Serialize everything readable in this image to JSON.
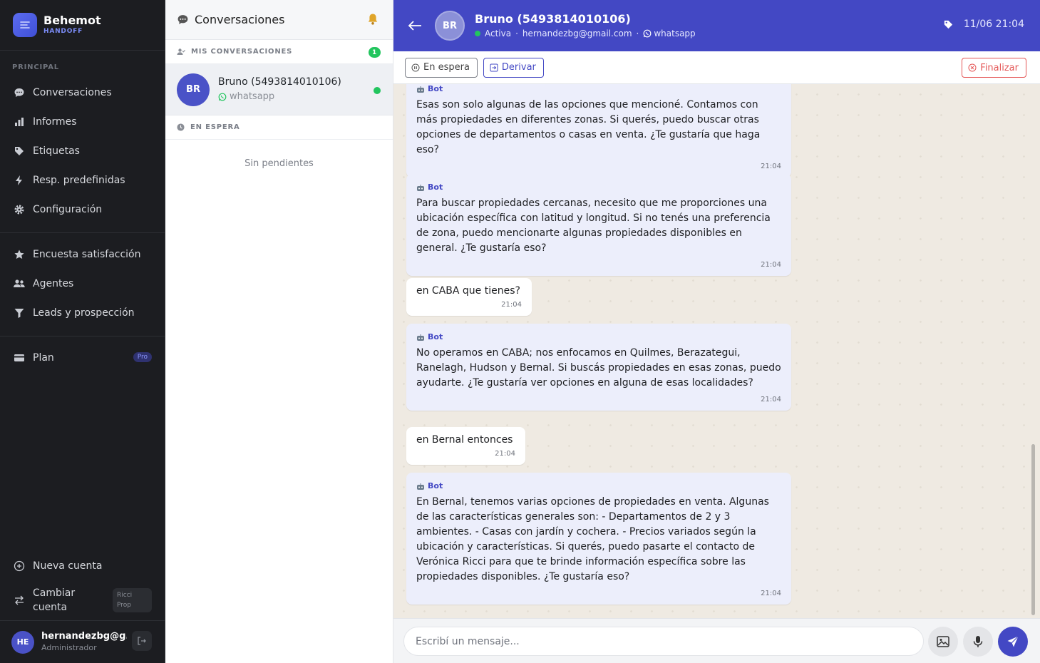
{
  "brand": {
    "name": "Behemot",
    "tag": "HANDOFF"
  },
  "nav": {
    "section": "PRINCIPAL",
    "items": [
      {
        "label": "Conversaciones",
        "icon": "chat-icon"
      },
      {
        "label": "Informes",
        "icon": "bar-chart-icon"
      },
      {
        "label": "Etiquetas",
        "icon": "tag-icon"
      },
      {
        "label": "Resp. predefinidas",
        "icon": "lightning-icon"
      },
      {
        "label": "Configuración",
        "icon": "gear-icon"
      }
    ],
    "items2": [
      {
        "label": "Encuesta satisfacción",
        "icon": "star-icon"
      },
      {
        "label": "Agentes",
        "icon": "users-icon"
      },
      {
        "label": "Leads y prospección",
        "icon": "filter-icon"
      }
    ],
    "plan": {
      "label": "Plan",
      "badge": "Pro"
    },
    "new_account": "Nueva cuenta",
    "switch_account": "Cambiar cuenta",
    "account_badge": "Ricci Prop",
    "user": {
      "initials": "HE",
      "name": "hernandezbg@g...",
      "role": "Administrador"
    }
  },
  "list": {
    "title": "Conversaciones",
    "mine_label": "MIS CONVERSACIONES",
    "mine_count": "1",
    "conversation": {
      "initials": "BR",
      "name": "Bruno (5493814010106)",
      "channel": "whatsapp"
    },
    "waiting_label": "EN ESPERA",
    "empty": "Sin pendientes"
  },
  "chat": {
    "initials": "BR",
    "name": "Bruno (5493814010106)",
    "status": "Activa",
    "email": "hernandezbg@gmail.com",
    "sep": "·",
    "channel": "whatsapp",
    "datetime": "11/06 21:04",
    "btn_wait": "En espera",
    "btn_derive": "Derivar",
    "btn_finish": "Finalizar",
    "messages": [
      {
        "from": "bot",
        "sender": "Bot",
        "text": "Esas son solo algunas de las opciones que mencioné. Contamos con más propiedades en diferentes zonas. Si querés, puedo buscar otras opciones de departamentos o casas en venta. ¿Te gustaría que haga eso?",
        "time": "21:04"
      },
      {
        "from": "bot",
        "sender": "Bot",
        "text": "Para buscar propiedades cercanas, necesito que me proporciones una ubicación específica con latitud y longitud. Si no tenés una preferencia de zona, puedo mencionarte algunas propiedades disponibles en general. ¿Te gustaría eso?",
        "time": "21:04"
      },
      {
        "from": "user",
        "text": "en CABA que tienes?",
        "time": "21:04"
      },
      {
        "from": "bot",
        "sender": "Bot",
        "text": "No operamos en CABA; nos enfocamos en Quilmes, Berazategui, Ranelagh, Hudson y Bernal. Si buscás propiedades en esas zonas, puedo ayudarte. ¿Te gustaría ver opciones en alguna de esas localidades?",
        "time": "21:04"
      },
      {
        "from": "user",
        "text": "en Bernal entonces",
        "time": "21:04"
      },
      {
        "from": "bot",
        "sender": "Bot",
        "text": "En Bernal, tenemos varias opciones de propiedades en venta. Algunas de las características generales son: - Departamentos de 2 y 3 ambientes. - Casas con jardín y cochera. - Precios variados según la ubicación y características. Si querés, puedo pasarte el contacto de Verónica Ricci para que te brinde información específica sobre las propiedades disponibles. ¿Te gustaría eso?",
        "time": "21:04"
      }
    ],
    "input_placeholder": "Escribí un mensaje..."
  },
  "colors": {
    "accent": "#4348c4",
    "online": "#22c55e",
    "danger": "#e45656"
  }
}
